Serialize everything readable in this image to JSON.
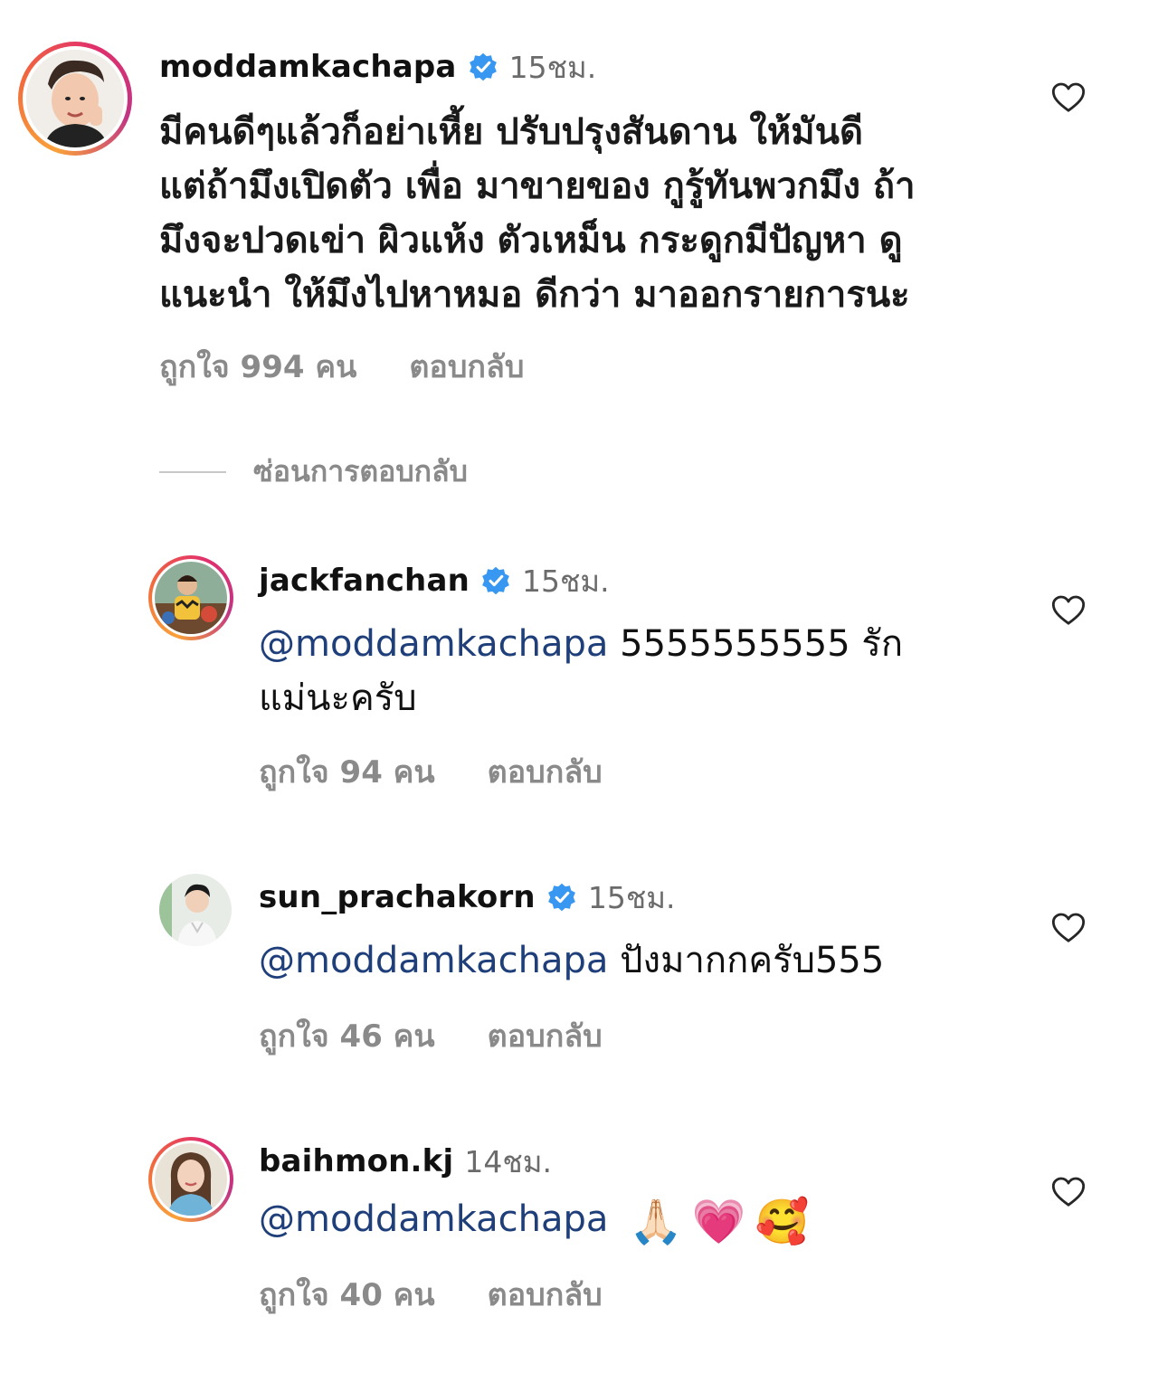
{
  "comment_main": {
    "username": "moddamkachapa",
    "time": "15ชม.",
    "lines": [
      "มีคนดีๆแล้วก็อย่าเหี้ย ปรับปรุงสันดาน ให้มันดี",
      "แต่ถ้ามึงเปิดตัว เพื่อ มาขายของ กูรู้ทันพวกมึง  ถ้า",
      "มึงจะปวดเข่า ผิวแห้ง ตัวเหม็น กระดูกมีปัญหา ดู",
      "แนะนำ ให้มึงไปหาหมอ ดีกว่า มาออกรายการนะ"
    ],
    "likes": "ถูกใจ 994 คน",
    "reply": "ตอบกลับ"
  },
  "hide_replies": "ซ่อนการตอบกลับ",
  "replies": [
    {
      "username": "jackfanchan",
      "time": "15ชม.",
      "mention": "@moddamkachapa",
      "text_line1": " 5555555555 รัก",
      "text_line2": "แม่นะครับ",
      "likes": "ถูกใจ 94 คน",
      "reply": "ตอบกลับ"
    },
    {
      "username": "sun_prachakorn",
      "time": "15ชม.",
      "mention": "@moddamkachapa",
      "text_line1": " ปังมากกครับ555",
      "likes": "ถูกใจ 46 คน",
      "reply": "ตอบกลับ"
    },
    {
      "username": "baihmon.kj",
      "time": "14ชม.",
      "mention": "@moddamkachapa",
      "emojis": [
        "🙏🏻",
        "💗",
        "🥰"
      ],
      "likes": "ถูกใจ 40 คน",
      "reply": "ตอบกลับ"
    }
  ],
  "colors": {
    "verified": "#3897f0",
    "mention": "#1f3f7a",
    "meta": "#8a8a8a",
    "heart_stroke": "#262626"
  }
}
